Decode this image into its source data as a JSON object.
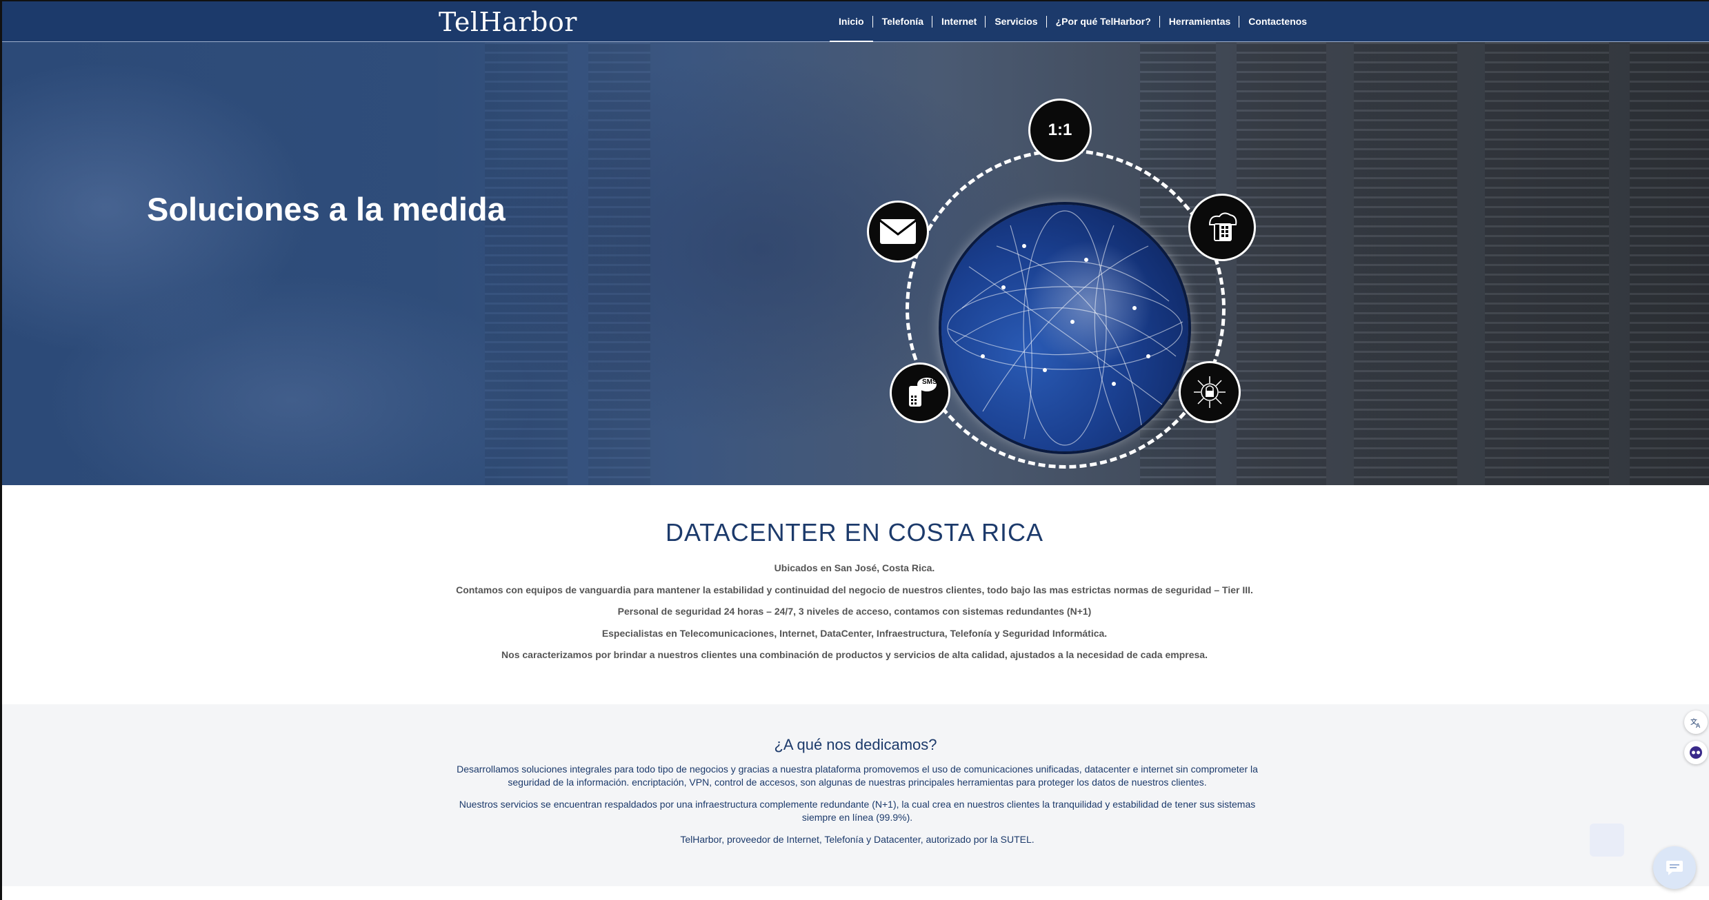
{
  "header": {
    "logo": "TelHarbor",
    "nav": [
      {
        "label": "Inicio",
        "active": true
      },
      {
        "label": "Telefonía",
        "active": false
      },
      {
        "label": "Internet",
        "active": false
      },
      {
        "label": "Servicios",
        "active": false
      },
      {
        "label": "¿Por qué TelHarbor?",
        "active": false
      },
      {
        "label": "Herramientas",
        "active": false
      },
      {
        "label": "Contactenos",
        "active": false
      }
    ]
  },
  "hero": {
    "title": "Soluciones a la medida",
    "icons": [
      "one-to-one-icon",
      "phone-cloud-icon",
      "lock-circuit-icon",
      "sms-phone-icon",
      "mail-icon"
    ],
    "icon_text": {
      "one_to_one": "1:1",
      "sms": "SMS"
    }
  },
  "datacenter": {
    "title": "DATACENTER EN COSTA RICA",
    "lines": [
      "Ubicados en San José, Costa Rica.",
      "Contamos con equipos de vanguardia para mantener la estabilidad y continuidad del negocio de nuestros clientes, todo bajo las mas estrictas normas de seguridad – Tier III.",
      "Personal de seguridad 24 horas – 24/7, 3 niveles de acceso, contamos con sistemas redundantes (N+1)",
      "Especialistas en Telecomunicaciones, Internet, DataCenter, Infraestructura, Telefonía y Seguridad Informática.",
      "Nos caracterizamos por brindar a nuestros clientes una combinación de productos y servicios de alta calidad, ajustados a la necesidad de cada empresa."
    ]
  },
  "dedicamos": {
    "title": "¿A qué nos dedicamos?",
    "paragraphs": [
      "Desarrollamos soluciones integrales para todo tipo de negocios y gracias a nuestra plataforma promovemos el uso de comunicaciones unificadas, datacenter e internet  sin comprometer la seguridad de la información. encriptación, VPN, control de accesos, son algunas de nuestras principales herramientas para proteger los datos de nuestros clientes.",
      "Nuestros servicios se encuentran respaldados por una infraestructura complemente redundante (N+1), la cual crea en nuestros clientes la tranquilidad y estabilidad de tener sus sistemas siempre en línea (99.9%).",
      "TelHarbor, proveedor de Internet, Telefonía y Datacenter, autorizado por la SUTEL."
    ]
  },
  "widgets": {
    "icons": [
      "translate-icon",
      "accessibility-icon",
      "chat-icon"
    ]
  },
  "colors": {
    "brand_navy": "#1c3a6b",
    "body_text": "#555555",
    "section_bg": "#f4f5f7"
  }
}
